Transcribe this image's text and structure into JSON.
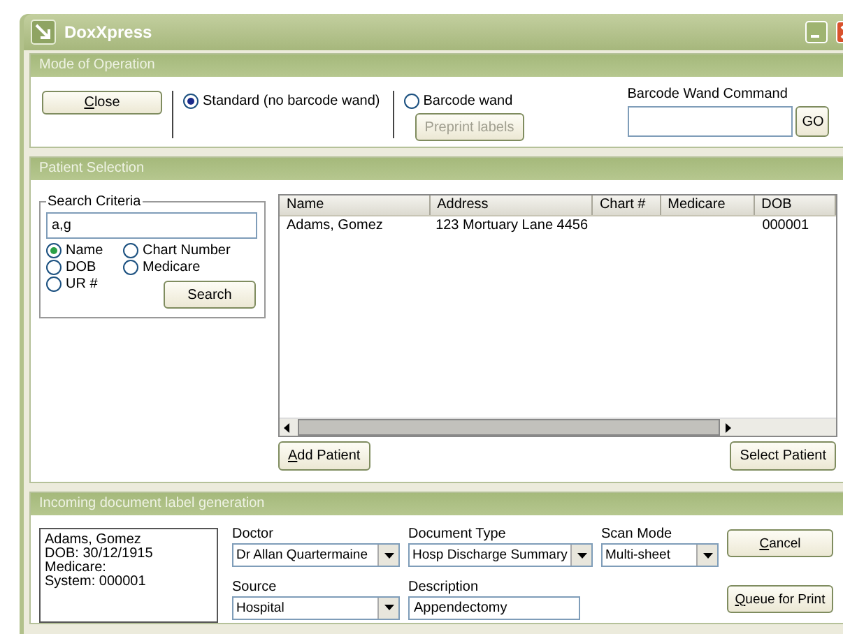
{
  "window": {
    "title": "DoxXpress"
  },
  "mode_of_operation": {
    "title": "Mode of Operation",
    "close_button": {
      "label": "Close",
      "access_key_underlined": true
    },
    "modes": [
      {
        "label": "Standard (no barcode wand)",
        "selected": true
      },
      {
        "label": "Barcode wand",
        "selected": false
      }
    ],
    "preprint_button": {
      "label": "Preprint labels",
      "disabled": true
    },
    "wand_command": {
      "label": "Barcode Wand Command"
    },
    "go_button": {
      "label": "GO"
    }
  },
  "patient_selection": {
    "title": "Patient Selection",
    "search_criteria": {
      "title": "Search Criteria",
      "query": "a,g",
      "options": [
        {
          "label": "Name",
          "selected": true
        },
        {
          "label": "Chart Number",
          "selected": false
        },
        {
          "label": "DOB",
          "selected": false
        },
        {
          "label": "Medicare",
          "selected": false
        },
        {
          "label": "UR #",
          "selected": false
        }
      ],
      "search_button": {
        "label": "Search"
      }
    },
    "table": {
      "columns": [
        "Name",
        "Address",
        "Chart #",
        "Medicare",
        "DOB"
      ],
      "rows": [
        [
          "Adams, Gomez",
          "123 Mortuary Lane  4456",
          "",
          "",
          "000001"
        ]
      ]
    },
    "add_patient_button": {
      "label": "Add Patient",
      "access_key_underlined": true
    },
    "select_patient_button": {
      "label": "Select Patient"
    }
  },
  "label_generation": {
    "title": "Incoming document label generation",
    "patient_info": [
      "Adams, Gomez",
      "DOB: 30/12/1915",
      "Medicare:",
      "System: 000001"
    ],
    "doctor": {
      "label": "Doctor",
      "value": "Dr Allan Quartermaine"
    },
    "document_type": {
      "label": "Document Type",
      "value": "Hosp Discharge Summary"
    },
    "scan_mode": {
      "label": "Scan Mode",
      "value": "Multi-sheet"
    },
    "source": {
      "label": "Source",
      "value": "Hospital"
    },
    "description": {
      "label": "Description",
      "value": "Appendectomy"
    },
    "cancel_button": {
      "label": "Cancel",
      "access_key_underlined": true
    },
    "queue_button": {
      "label": "Queue for Print",
      "access_key_underlined": true
    }
  }
}
